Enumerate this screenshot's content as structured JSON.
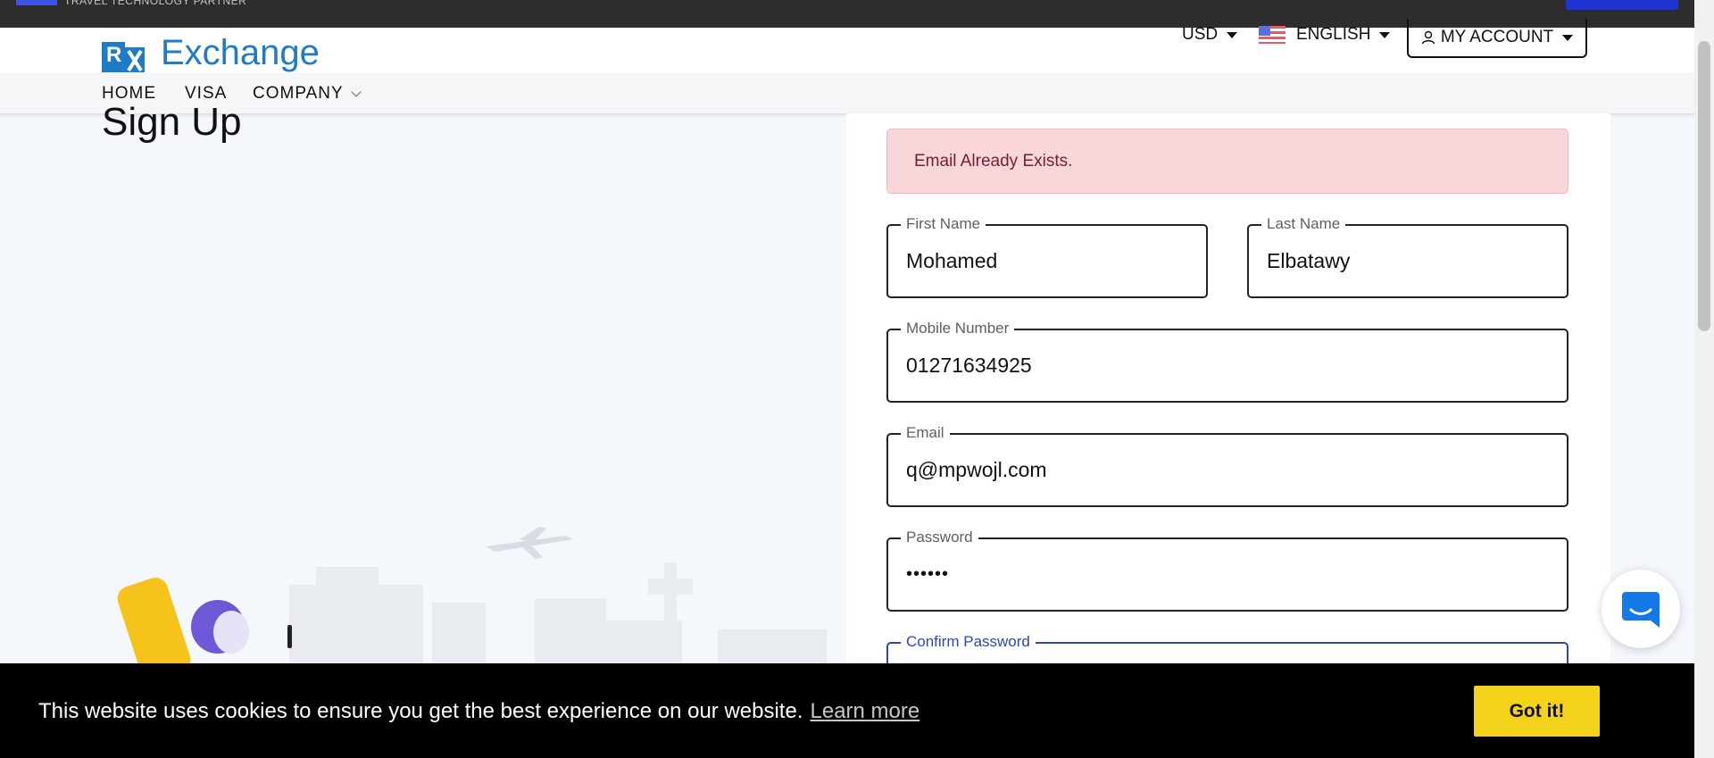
{
  "topbar": {
    "tagline": "TRAVEL TECHNOLOGY PARTNER"
  },
  "header": {
    "logo_text": "Exchange",
    "currency": "USD",
    "language": "ENGLISH",
    "account_label": "MY ACCOUNT"
  },
  "nav": {
    "items": [
      "HOME",
      "VISA",
      "COMPANY"
    ]
  },
  "page": {
    "title": "Sign Up"
  },
  "form": {
    "alert": "Email Already Exists.",
    "first_name": {
      "label": "First Name",
      "value": "Mohamed"
    },
    "last_name": {
      "label": "Last Name",
      "value": "Elbatawy"
    },
    "mobile": {
      "label": "Mobile Number",
      "value": "01271634925"
    },
    "email": {
      "label": "Email",
      "value": "q@mpwojl.com"
    },
    "password": {
      "label": "Password",
      "value": "••••••"
    },
    "confirm_password": {
      "label": "Confirm Password",
      "value": ""
    }
  },
  "cookie": {
    "message": "This website uses cookies to ensure you get the best experience on our website.",
    "learn_more": "Learn more",
    "accept": "Got it!"
  },
  "colors": {
    "brand_blue": "#1e7cc6",
    "alert_bg": "#f8d6da",
    "alert_text": "#7a1d28",
    "focus_blue": "#2b47b5",
    "cookie_button": "#f2d21a"
  },
  "icons": [
    "user-icon",
    "us-flag-icon",
    "chat-icon",
    "chevron-down-icon"
  ]
}
